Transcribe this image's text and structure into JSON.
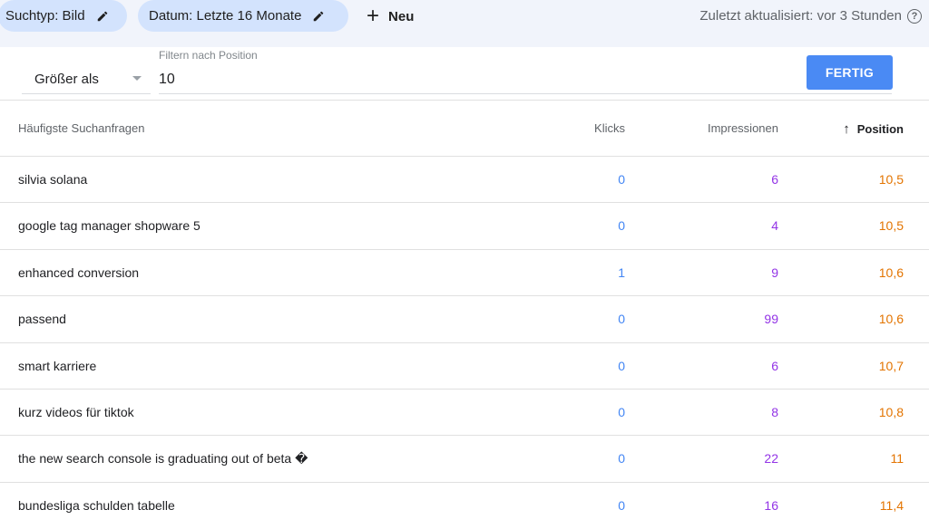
{
  "topbar": {
    "chip_type": "Suchtyp: Bild",
    "chip_date": "Datum: Letzte 16 Monate",
    "new_label": "Neu",
    "updated": "Zuletzt aktualisiert: vor 3 Stunden",
    "help_icon": "?"
  },
  "filter": {
    "operator": "Größer als",
    "label": "Filtern nach Position",
    "value": "10",
    "done_label": "FERTIG"
  },
  "table": {
    "headers": {
      "query": "Häufigste Suchanfragen",
      "clicks": "Klicks",
      "impressions": "Impressionen",
      "position": "Position"
    },
    "rows": [
      {
        "query": "silvia solana",
        "clicks": "0",
        "impressions": "6",
        "position": "10,5"
      },
      {
        "query": "google tag manager shopware 5",
        "clicks": "0",
        "impressions": "4",
        "position": "10,5"
      },
      {
        "query": "enhanced conversion",
        "clicks": "1",
        "impressions": "9",
        "position": "10,6"
      },
      {
        "query": "passend",
        "clicks": "0",
        "impressions": "99",
        "position": "10,6"
      },
      {
        "query": "smart karriere",
        "clicks": "0",
        "impressions": "6",
        "position": "10,7"
      },
      {
        "query": "kurz videos für tiktok",
        "clicks": "0",
        "impressions": "8",
        "position": "10,8"
      },
      {
        "query": "the new search console is graduating out of beta �",
        "clicks": "0",
        "impressions": "22",
        "position": "11"
      },
      {
        "query": "bundesliga schulden tabelle",
        "clicks": "0",
        "impressions": "16",
        "position": "11,4"
      }
    ]
  },
  "colors": {
    "clicks": "#4285f4",
    "impressions": "#9334e6",
    "position": "#e37400",
    "accent": "#4a8af4"
  }
}
